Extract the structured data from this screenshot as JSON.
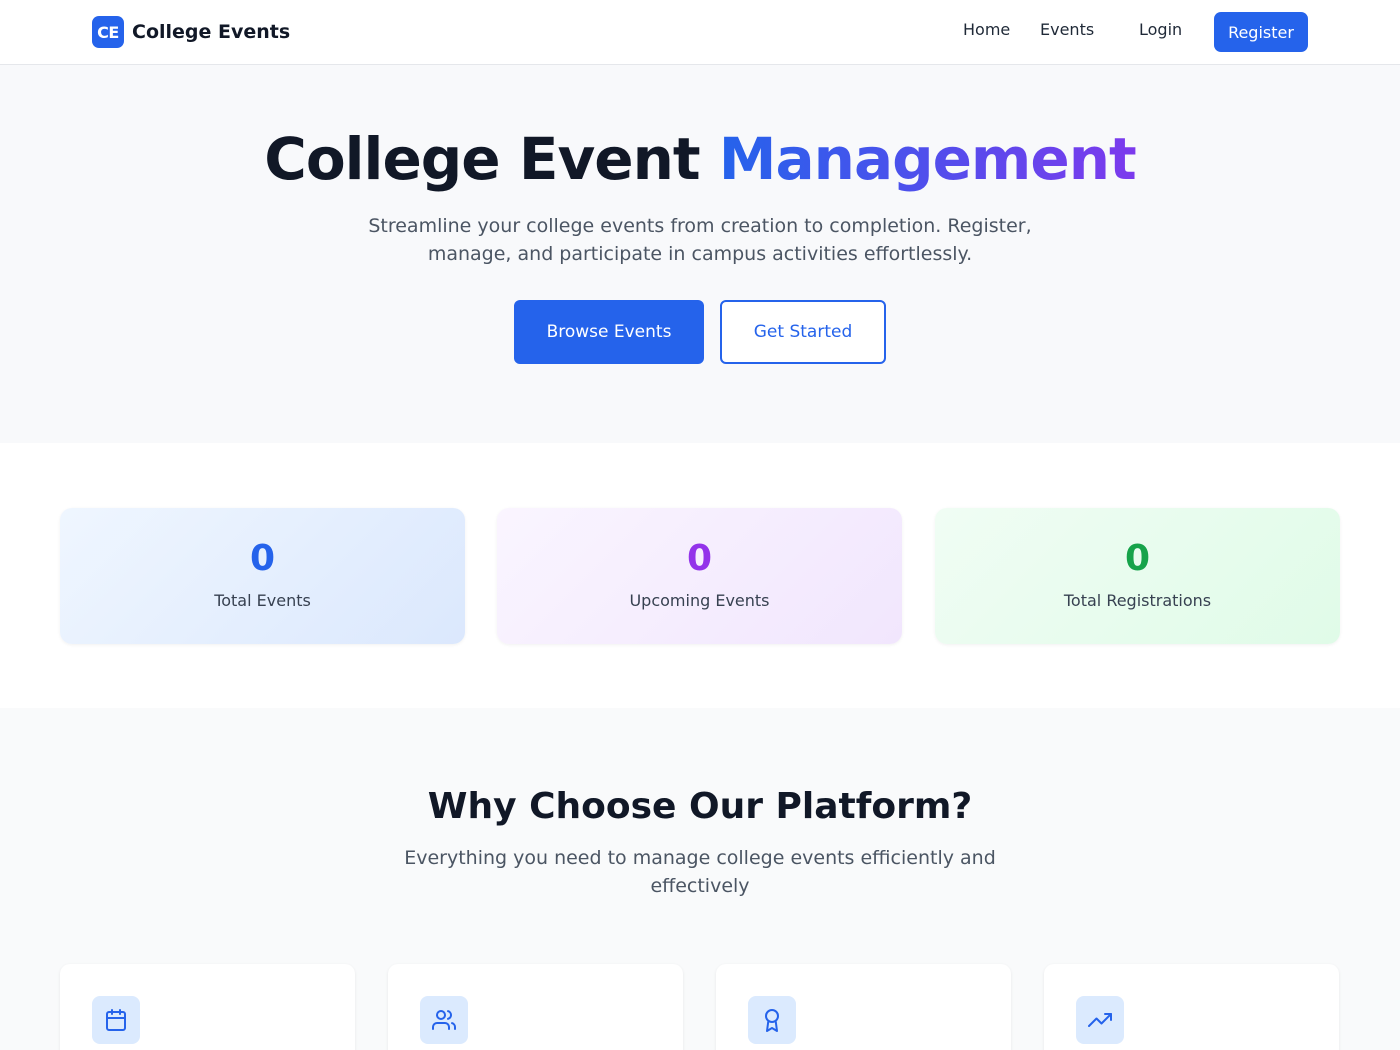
{
  "navbar": {
    "logo_text": "CE",
    "brand": "College Events",
    "links": [
      "Home",
      "Events",
      "Login"
    ],
    "register": "Register"
  },
  "hero": {
    "title_part1": "College Event ",
    "title_part2": "Management",
    "subtitle": "Streamline your college events from creation to completion. Register, manage, and participate in campus activities effortlessly.",
    "primary_button": "Browse Events",
    "secondary_button": "Get Started",
    "accent_colors": [
      "#2563eb",
      "#7c3aed"
    ]
  },
  "stats": [
    {
      "value": "0",
      "label": "Total Events",
      "color": "#2563eb"
    },
    {
      "value": "0",
      "label": "Upcoming Events",
      "color": "#9333ea"
    },
    {
      "value": "0",
      "label": "Total Registrations",
      "color": "#16a34a"
    }
  ],
  "features": {
    "title": "Why Choose Our Platform?",
    "subtitle": "Everything you need to manage college events efficiently and effectively",
    "cards": [
      {
        "icon": "calendar-icon"
      },
      {
        "icon": "users-icon"
      },
      {
        "icon": "award-icon"
      },
      {
        "icon": "trending-up-icon"
      }
    ]
  }
}
